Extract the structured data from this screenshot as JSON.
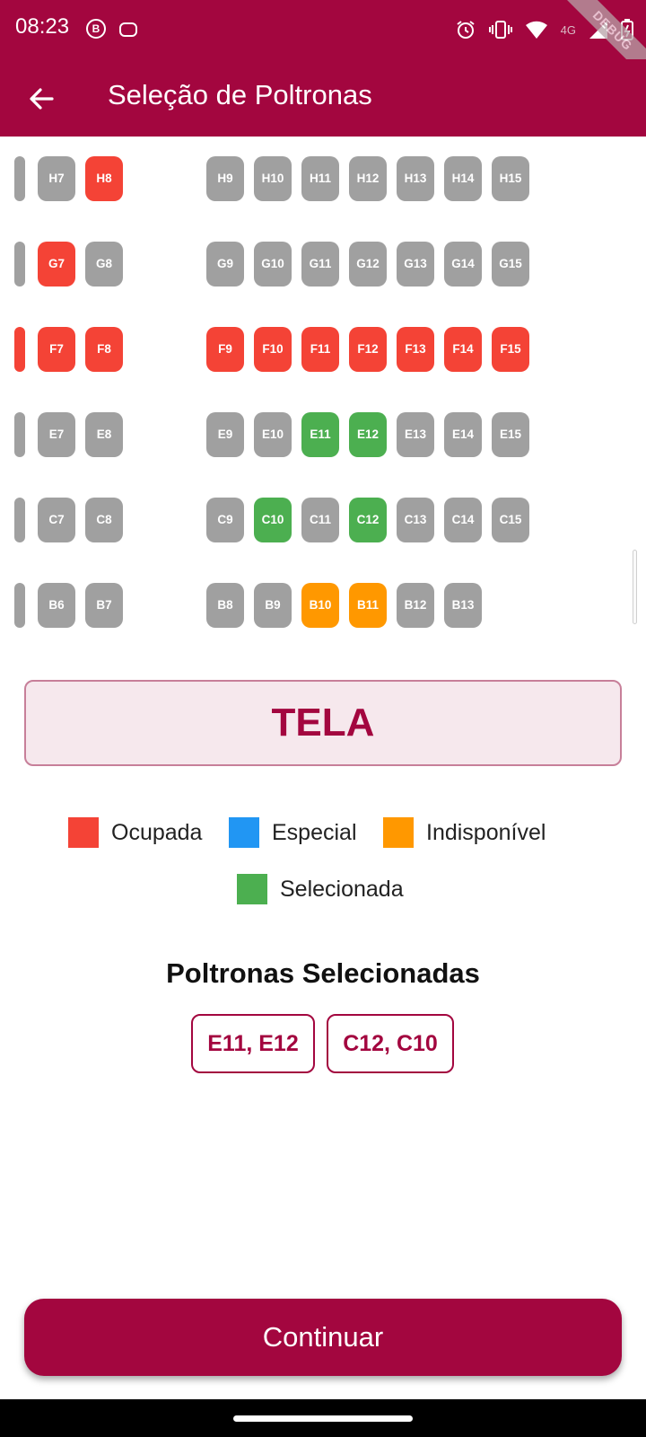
{
  "status_bar": {
    "time": "08:23",
    "left_icons": [
      "whatsapp-business-icon",
      "message-icon"
    ],
    "right_icons": [
      "alarm-icon",
      "vibrate-icon",
      "wifi-icon",
      "signal-icon",
      "battery-icon"
    ],
    "network_label": "4G",
    "debug_label": "DEBUG"
  },
  "app_bar": {
    "title": "Seleção de Poltronas",
    "back_icon": "arrow-back-icon"
  },
  "colors": {
    "primary": "#a3063f",
    "available": "#a0a0a0",
    "occupied": "#f44336",
    "special": "#2196f3",
    "unavailable": "#ff9800",
    "selected": "#4caf50"
  },
  "seat_rows": [
    {
      "row": "H",
      "seats": [
        {
          "label": "",
          "status": "available",
          "partial": true
        },
        {
          "label": "H7",
          "status": "available"
        },
        {
          "label": "H8",
          "status": "occupied"
        },
        {
          "label": "H9",
          "status": "available"
        },
        {
          "label": "H10",
          "status": "available"
        },
        {
          "label": "H11",
          "status": "available"
        },
        {
          "label": "H12",
          "status": "available"
        },
        {
          "label": "H13",
          "status": "available"
        },
        {
          "label": "H14",
          "status": "available"
        },
        {
          "label": "H15",
          "status": "available"
        }
      ]
    },
    {
      "row": "G",
      "seats": [
        {
          "label": "",
          "status": "available",
          "partial": true
        },
        {
          "label": "G7",
          "status": "occupied"
        },
        {
          "label": "G8",
          "status": "available"
        },
        {
          "label": "G9",
          "status": "available"
        },
        {
          "label": "G10",
          "status": "available"
        },
        {
          "label": "G11",
          "status": "available"
        },
        {
          "label": "G12",
          "status": "available"
        },
        {
          "label": "G13",
          "status": "available"
        },
        {
          "label": "G14",
          "status": "available"
        },
        {
          "label": "G15",
          "status": "available"
        }
      ]
    },
    {
      "row": "F",
      "seats": [
        {
          "label": "",
          "status": "occupied",
          "partial": true
        },
        {
          "label": "F7",
          "status": "occupied"
        },
        {
          "label": "F8",
          "status": "occupied"
        },
        {
          "label": "F9",
          "status": "occupied"
        },
        {
          "label": "F10",
          "status": "occupied"
        },
        {
          "label": "F11",
          "status": "occupied"
        },
        {
          "label": "F12",
          "status": "occupied"
        },
        {
          "label": "F13",
          "status": "occupied"
        },
        {
          "label": "F14",
          "status": "occupied"
        },
        {
          "label": "F15",
          "status": "occupied"
        }
      ]
    },
    {
      "row": "E",
      "seats": [
        {
          "label": "",
          "status": "available",
          "partial": true
        },
        {
          "label": "E7",
          "status": "available"
        },
        {
          "label": "E8",
          "status": "available"
        },
        {
          "label": "E9",
          "status": "available"
        },
        {
          "label": "E10",
          "status": "available"
        },
        {
          "label": "E11",
          "status": "selected"
        },
        {
          "label": "E12",
          "status": "selected"
        },
        {
          "label": "E13",
          "status": "available"
        },
        {
          "label": "E14",
          "status": "available"
        },
        {
          "label": "E15",
          "status": "available"
        }
      ]
    },
    {
      "row": "C",
      "seats": [
        {
          "label": "",
          "status": "available",
          "partial": true
        },
        {
          "label": "C7",
          "status": "available"
        },
        {
          "label": "C8",
          "status": "available"
        },
        {
          "label": "C9",
          "status": "available"
        },
        {
          "label": "C10",
          "status": "selected"
        },
        {
          "label": "C11",
          "status": "available"
        },
        {
          "label": "C12",
          "status": "selected"
        },
        {
          "label": "C13",
          "status": "available"
        },
        {
          "label": "C14",
          "status": "available"
        },
        {
          "label": "C15",
          "status": "available"
        }
      ]
    },
    {
      "row": "B",
      "seats": [
        {
          "label": "",
          "status": "available",
          "partial": true
        },
        {
          "label": "B6",
          "status": "available"
        },
        {
          "label": "B7",
          "status": "available"
        },
        {
          "label": "B8",
          "status": "available"
        },
        {
          "label": "B9",
          "status": "available"
        },
        {
          "label": "B10",
          "status": "unavailable"
        },
        {
          "label": "B11",
          "status": "unavailable"
        },
        {
          "label": "B12",
          "status": "available"
        },
        {
          "label": "B13",
          "status": "available"
        }
      ]
    }
  ],
  "screen_label": "TELA",
  "legend": [
    {
      "label": "Ocupada",
      "status": "occupied"
    },
    {
      "label": "Especial",
      "status": "special"
    },
    {
      "label": "Indisponível",
      "status": "unavailable"
    },
    {
      "label": "Selecionada",
      "status": "selected"
    }
  ],
  "selected_section": {
    "title": "Poltronas Selecionadas",
    "chips": [
      "E11, E12",
      "C12, C10"
    ]
  },
  "continue_label": "Continuar"
}
